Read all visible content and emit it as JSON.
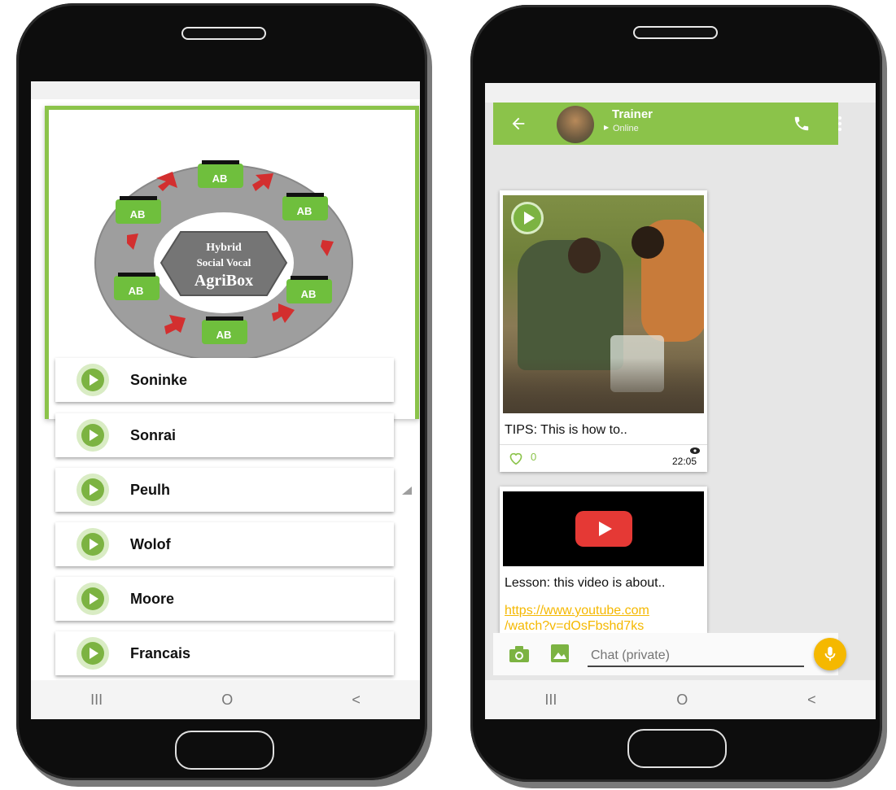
{
  "left_app": {
    "diagram": {
      "center_line1": "Hybrid",
      "center_line2": "Social Vocal",
      "center_line3": "AgriBox",
      "node_label": "AB"
    },
    "languages": [
      {
        "label": "Soninke"
      },
      {
        "label": "Sonrai"
      },
      {
        "label": "Peulh"
      },
      {
        "label": "Wolof"
      },
      {
        "label": "Moore"
      },
      {
        "label": "Francais"
      }
    ],
    "nav": {
      "recents": "III",
      "home": "O",
      "back": "<"
    }
  },
  "right_app": {
    "header": {
      "name": "Trainer",
      "status": "Online"
    },
    "messages": [
      {
        "caption": "TIPS: This is how to..",
        "likes": "0",
        "time": "22:05"
      },
      {
        "caption": "Lesson: this video is about..",
        "link_line1": "https://www.youtube.com",
        "link_line2": "/watch?v=dOsFbshd7ks"
      }
    ],
    "input": {
      "placeholder": "Chat (private)"
    },
    "nav": {
      "recents": "III",
      "home": "O",
      "back": "<"
    }
  },
  "colors": {
    "accent": "#8bc34a",
    "accent_dark": "#7cb342",
    "mic": "#f5b800",
    "youtube": "#e53935"
  },
  "icons": [
    "play-icon",
    "back-arrow-icon",
    "phone-icon",
    "more-vert-icon",
    "camera-icon",
    "image-icon",
    "mic-icon",
    "eye-icon",
    "heart-icon",
    "youtube-play-icon"
  ]
}
